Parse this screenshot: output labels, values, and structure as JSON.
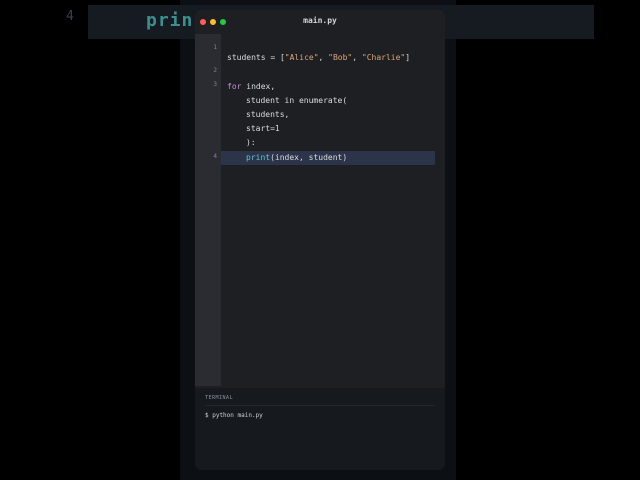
{
  "background": {
    "line_number": "4",
    "code_fragment": "prin"
  },
  "window": {
    "title": "main.py",
    "controls": {
      "close": "#ff5f57",
      "minimize": "#febc2e",
      "maximize": "#28c840"
    }
  },
  "editor": {
    "line_numbers": [
      "1",
      "2",
      "3",
      "4"
    ],
    "lines": {
      "l1_var": "students = [",
      "l1_s1": "\"Alice\"",
      "l1_sep1": ", ",
      "l1_s2": "\"Bob\"",
      "l1_sep2": ", ",
      "l1_s3": "\"Charlie\"",
      "l1_end": "]",
      "l3_kw": "for",
      "l3_rest": " index,",
      "l3b": "student in enumerate(",
      "l3c": "students,",
      "l3d": "start=1",
      "l3e": "):",
      "l4_fn": "print",
      "l4_rest": "(index, student)"
    }
  },
  "terminal": {
    "title": "TERMINAL",
    "command": "$ python main.py"
  }
}
